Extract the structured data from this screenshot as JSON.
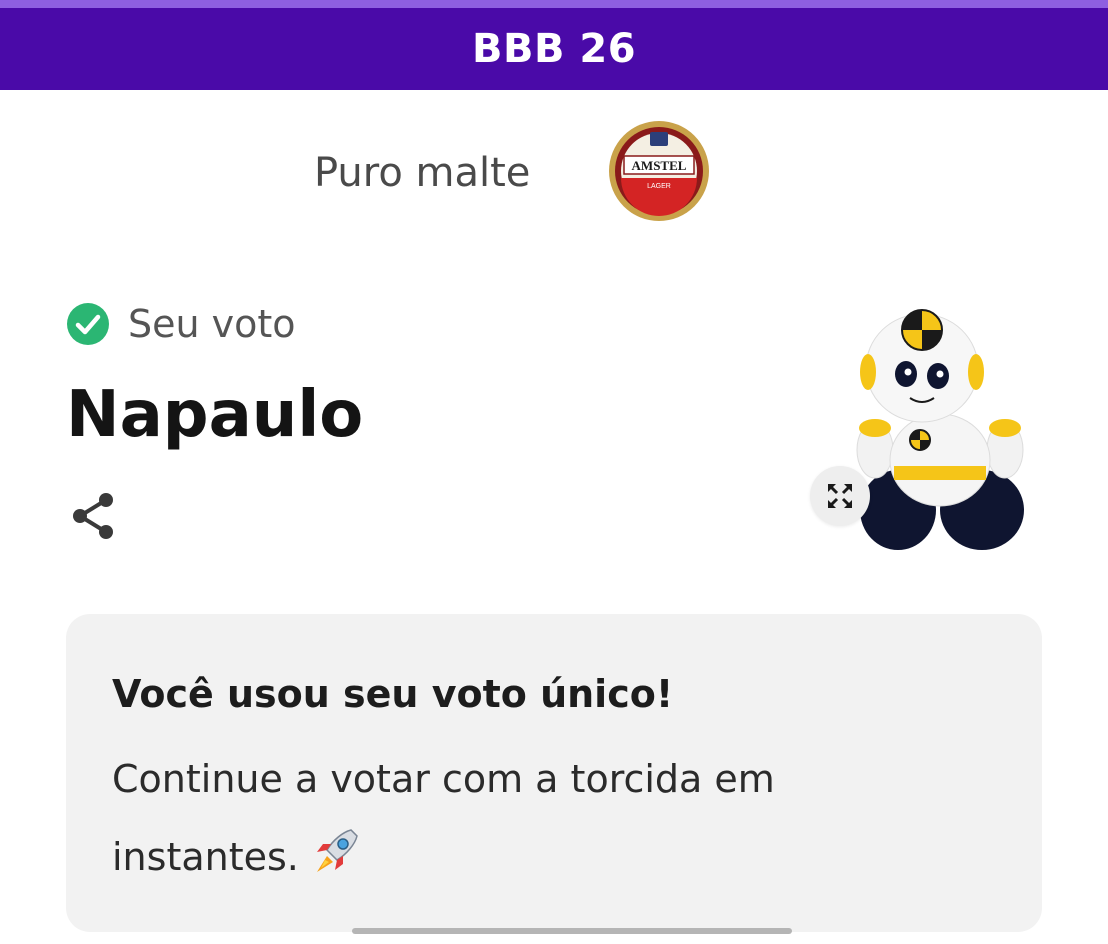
{
  "header": {
    "title": "BBB 26"
  },
  "sponsor": {
    "text": "Puro malte",
    "logo_icon": "amstel-logo",
    "logo_text": "AMSTEL",
    "logo_subtext": "LAGER"
  },
  "vote": {
    "label": "Seu voto",
    "name": "Napaulo",
    "check_icon": "check-circle-icon",
    "share_icon": "share-icon",
    "expand_icon": "expand-icon"
  },
  "card": {
    "title": "Você usou seu voto único!",
    "body": "Continue a votar com a torcida em instantes.",
    "emoji_icon": "rocket-icon"
  },
  "colors": {
    "header_bg": "#4a0aa8",
    "header_accent": "#8e5fe0",
    "check_green": "#2bb673",
    "card_bg": "#f2f2f2"
  }
}
